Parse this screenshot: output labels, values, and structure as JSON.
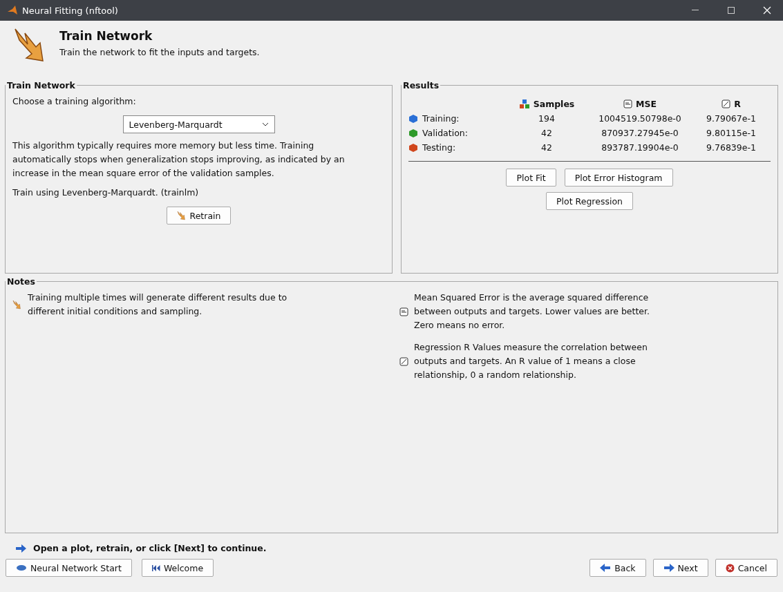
{
  "window": {
    "title": "Neural Fitting (nftool)"
  },
  "header": {
    "title": "Train Network",
    "subtitle": "Train the network to fit the inputs and targets."
  },
  "train_panel": {
    "title": "Train Network",
    "prompt": "Choose a training algorithm:",
    "algorithm": "Levenberg-Marquardt",
    "description": "This algorithm typically requires more memory but less time. Training automatically stops when generalization stops improving, as indicated by an increase in the mean square error of the validation samples.",
    "method": "Train using Levenberg-Marquardt.  (trainlm)",
    "button": "Retrain"
  },
  "results": {
    "title": "Results",
    "columns": [
      "Samples",
      "MSE",
      "R"
    ],
    "rows": [
      {
        "label": "Training:",
        "color": "#2a6fd6",
        "samples": "194",
        "mse": "1004519.50798e-0",
        "r": "9.79067e-1"
      },
      {
        "label": "Validation:",
        "color": "#2f9a2a",
        "samples": "42",
        "mse": "870937.27945e-0",
        "r": "9.80115e-1"
      },
      {
        "label": "Testing:",
        "color": "#d0461c",
        "samples": "42",
        "mse": "893787.19904e-0",
        "r": "9.76839e-1"
      }
    ],
    "buttons": [
      "Plot Fit",
      "Plot Error Histogram",
      "Plot Regression"
    ]
  },
  "notes": {
    "title": "Notes",
    "left": "Training multiple times will generate different results due to different initial conditions and sampling.",
    "mse": "Mean Squared Error is the average squared difference between outputs and targets. Lower values are better. Zero means no error.",
    "r": "Regression R Values measure the correlation between outputs and targets. An R value of 1 means a close relationship, 0 a random relationship."
  },
  "hint": "Open a plot, retrain, or click [Next] to continue.",
  "footer": {
    "left": [
      "Neural Network Start",
      "Welcome"
    ],
    "right": [
      "Back",
      "Next",
      "Cancel"
    ]
  }
}
